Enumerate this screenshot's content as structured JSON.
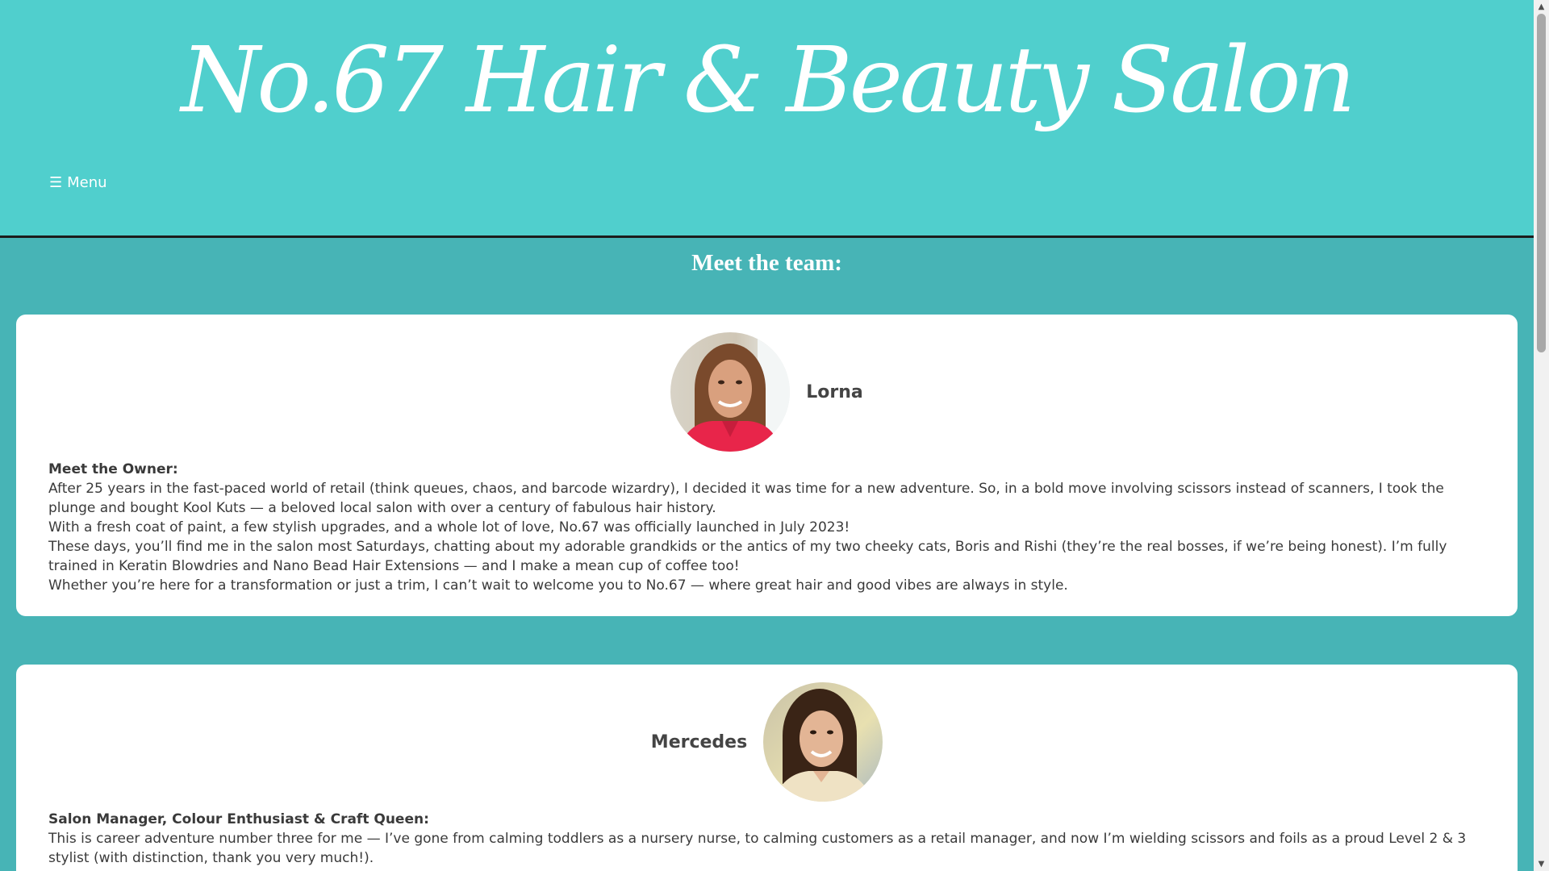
{
  "header": {
    "site_title": "No.67 Hair & Beauty Salon",
    "menu_icon": "☰",
    "menu_label": "Menu"
  },
  "main": {
    "section_title": "Meet the team:",
    "team": [
      {
        "name": "Lorna",
        "role": "Meet the Owner:",
        "paragraphs": [
          "After 25 years in the fast-paced world of retail (think queues, chaos, and barcode wizardry), I decided it was time for a new adventure. So, in a bold move involving scissors instead of scanners, I took the plunge and bought Kool Kuts — a beloved local salon with over a century of fabulous hair history.",
          "With a fresh coat of paint, a few stylish upgrades, and a whole lot of love, No.67 was officially launched in July 2023!",
          "These days, you’ll find me in the salon most Saturdays, chatting about my adorable grandkids or the antics of my two cheeky cats, Boris and Rishi (they’re the real bosses, if we’re being honest). I’m fully trained in Keratin Blowdries and Nano Bead Hair Extensions — and I make a mean cup of coffee too!",
          "Whether you’re here for a transformation or just a trim, I can’t wait to welcome you to No.67 — where great hair and good vibes are always in style."
        ]
      },
      {
        "name": "Mercedes",
        "role": "Salon Manager, Colour Enthusiast & Craft Queen:",
        "paragraphs": [
          "This is career adventure number three for me — I’ve gone from calming toddlers as a nursery nurse, to calming customers as a retail manager, and now I’m wielding scissors and foils as a proud Level 2 & 3 stylist (with distinction, thank you very much!)."
        ]
      }
    ]
  },
  "colors": {
    "header_bg": "#50cfcd",
    "page_bg": "#47b4b6",
    "card_bg": "#ffffff",
    "text": "#3a3a3a"
  }
}
